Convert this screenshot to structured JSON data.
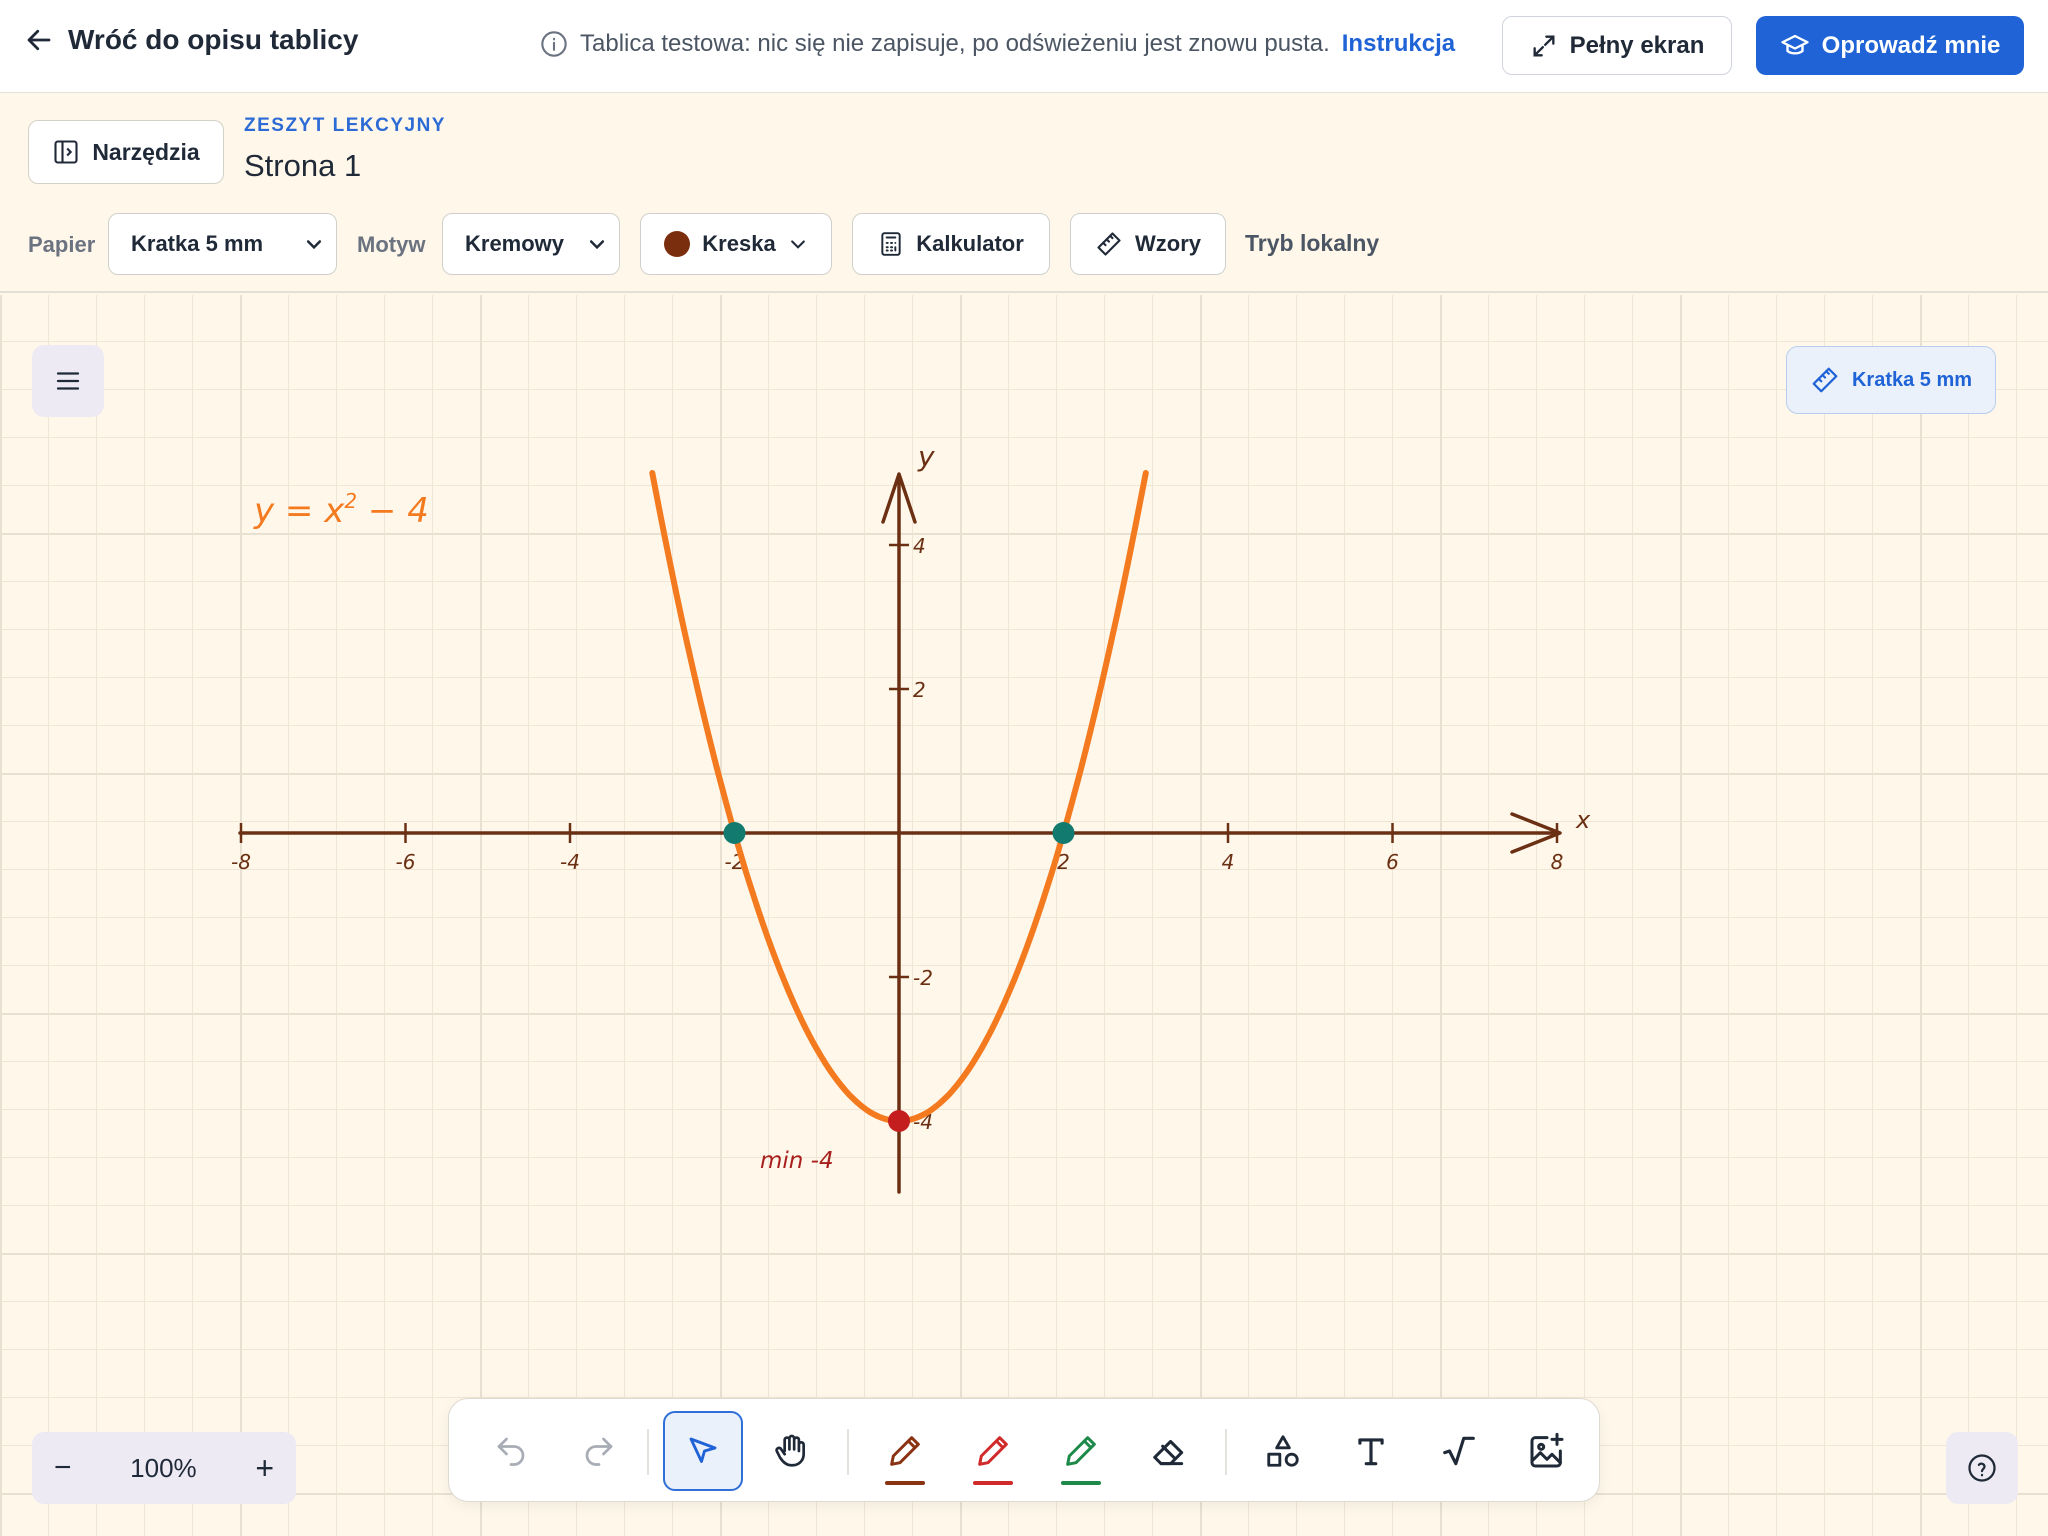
{
  "topbar": {
    "back_label": "Wróć do opisu tablicy",
    "notice_text": "Tablica testowa: nic się nie zapisuje, po odświeżeniu jest znowu pusta.",
    "notice_link": "Instrukcja",
    "fullscreen_label": "Pełny ekran",
    "tour_label": "Oprowadź mnie"
  },
  "subbar": {
    "tools_label": "Narzędzia",
    "kicker": "ZESZYT LEKCYJNY",
    "page_title": "Strona 1",
    "paper_label": "Papier",
    "paper_value": "Kratka 5 mm",
    "theme_label": "Motyw",
    "theme_value": "Kremowy",
    "stroke_label": "Kreska",
    "stroke_color": "#7a2e0e",
    "calculator_label": "Kalkulator",
    "formulas_label": "Wzory",
    "local_mode": "Tryb lokalny"
  },
  "canvas": {
    "grid_badge": "Kratka 5 mm",
    "equation_main": "y = x",
    "equation_exp": "2",
    "equation_tail": " − 4",
    "axis_x_label": "x",
    "axis_y_label": "y",
    "min_label": "min -4",
    "x_ticks": [
      "-8",
      "-6",
      "-4",
      "-2",
      "2",
      "4",
      "6",
      "8"
    ],
    "y_ticks": [
      "4",
      "2",
      "-2",
      "-4"
    ],
    "function": "x^2-4",
    "curve_x_range": [
      -3,
      3
    ],
    "roots": [
      -2,
      2
    ],
    "vertex": [
      0,
      -4
    ],
    "colors": {
      "curve": "#f47a20",
      "axis": "#6b3014",
      "root": "#137a70",
      "vertex": "#c41e1e",
      "equation": "#f47a20"
    }
  },
  "toolbar": {
    "tools": [
      "undo-icon",
      "redo-icon",
      "select-icon",
      "hand-icon",
      "pen-brown-icon",
      "pen-red-icon",
      "pen-green-icon",
      "eraser-icon",
      "shapes-icon",
      "text-icon",
      "sqrt-icon",
      "image-add-icon"
    ],
    "pen_colors": [
      "#8a3312",
      "#d12a2a",
      "#1e8a4a"
    ]
  },
  "zoom": {
    "value": "100%",
    "minus": "−",
    "plus": "+"
  }
}
